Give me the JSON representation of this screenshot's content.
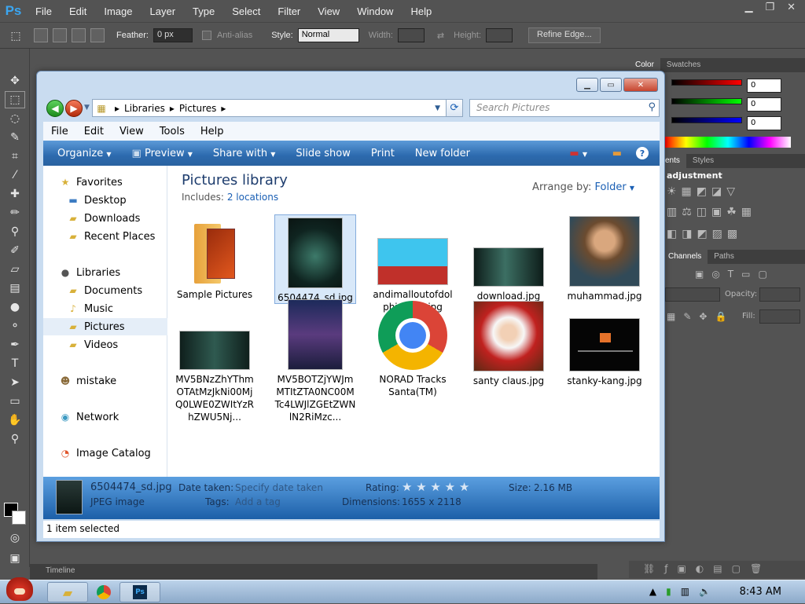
{
  "photoshop": {
    "logo": "Ps",
    "menu": [
      "File",
      "Edit",
      "Image",
      "Layer",
      "Type",
      "Select",
      "Filter",
      "View",
      "Window",
      "Help"
    ],
    "options": {
      "feather_label": "Feather:",
      "feather_value": "0 px",
      "antialias_label": "Anti-alias",
      "style_label": "Style:",
      "style_value": "Normal",
      "width_label": "Width:",
      "height_label": "Height:",
      "refine_edge_label": "Refine Edge..."
    },
    "panels": {
      "color_tab": "Color",
      "swatches_tab": "Swatches",
      "color_r": "0",
      "color_g": "0",
      "color_b": "0",
      "adjustments_tab": "ents",
      "styles_tab": "Styles",
      "adjustment_title": "adjustment",
      "channels_tab": "Channels",
      "paths_tab": "Paths",
      "opacity_label": "Opacity:",
      "fill_label": "Fill:"
    },
    "timeline_label": "Timeline"
  },
  "explorer": {
    "breadcrumb": [
      "Libraries",
      "Pictures"
    ],
    "search_placeholder": "Search Pictures",
    "menu": [
      "File",
      "Edit",
      "View",
      "Tools",
      "Help"
    ],
    "commands": [
      "Organize",
      "Preview",
      "Share with",
      "Slide show",
      "Print",
      "New folder"
    ],
    "nav": {
      "favorites": "Favorites",
      "desktop": "Desktop",
      "downloads": "Downloads",
      "recent": "Recent Places",
      "libraries": "Libraries",
      "documents": "Documents",
      "music": "Music",
      "pictures": "Pictures",
      "videos": "Videos",
      "mistake": "mistake",
      "network": "Network",
      "catalog": "Image Catalog"
    },
    "library_title": "Pictures library",
    "includes_label": "Includes:",
    "includes_link": "2 locations",
    "arrange_label": "Arrange by:",
    "arrange_value": "Folder",
    "files": [
      {
        "name": "Sample Pictures"
      },
      {
        "name": "6504474_sd.jpg"
      },
      {
        "name": "andimalloutofdolphinporn.jpg"
      },
      {
        "name": "download.jpg"
      },
      {
        "name": "muhammad.jpg"
      },
      {
        "name": "MV5BNzZhYThmOTAtMzJkNi00MjQ0LWE0ZWItYzRhZWU5Nj..."
      },
      {
        "name": "MV5BOTZjYWJmMTItZTA0NC00MTc4LWJlZGEtZWNlN2RiMzc..."
      },
      {
        "name": "NORAD Tracks Santa(TM)"
      },
      {
        "name": "santy claus.jpg"
      },
      {
        "name": "stanky-kang.jpg"
      }
    ],
    "details": {
      "filename": "6504474_sd.jpg",
      "filetype": "JPEG image",
      "date_taken_label": "Date taken:",
      "date_taken_value": "Specify date taken",
      "tags_label": "Tags:",
      "tags_value": "Add a tag",
      "rating_label": "Rating:",
      "rating_stars": "★ ★ ★ ★ ★",
      "dimensions_label": "Dimensions:",
      "dimensions_value": "1655 x 2118",
      "size_label": "Size:",
      "size_value": "2.16 MB"
    },
    "status": "1 item selected"
  },
  "taskbar": {
    "clock": "8:43 AM"
  }
}
